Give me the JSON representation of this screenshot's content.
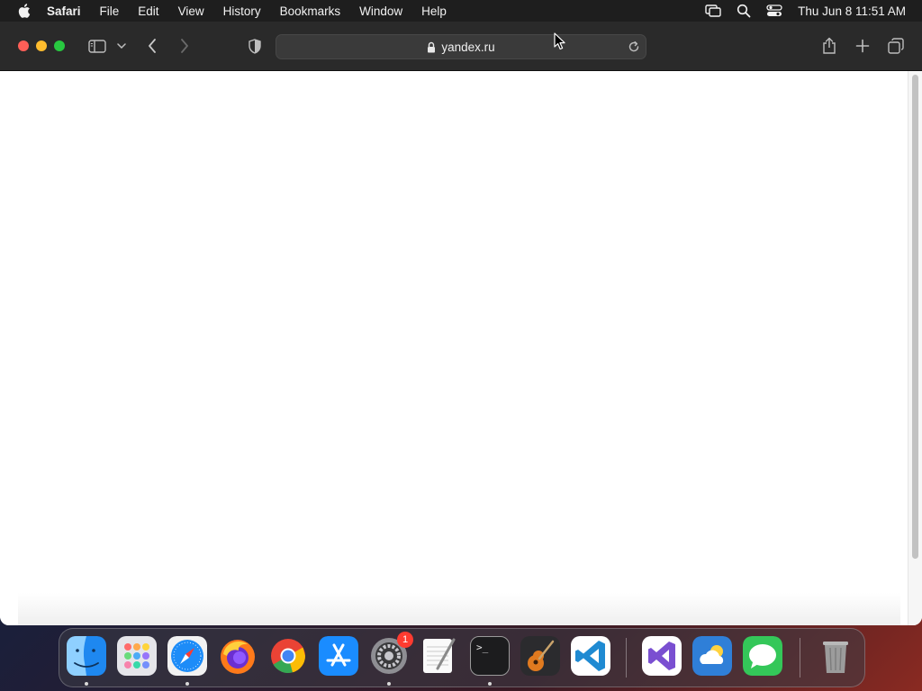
{
  "menubar": {
    "app_name": "Safari",
    "items": [
      "File",
      "Edit",
      "View",
      "History",
      "Bookmarks",
      "Window",
      "Help"
    ],
    "clock": "Thu Jun 8  11:51 AM"
  },
  "browser": {
    "url": "yandex.ru"
  },
  "dock": {
    "settings_badge": "1",
    "terminal_prompt": ">_"
  },
  "colors": {
    "close": "#fe5f57",
    "minimize": "#febc2e",
    "maximize": "#28c840",
    "badge": "#ff3b30"
  }
}
